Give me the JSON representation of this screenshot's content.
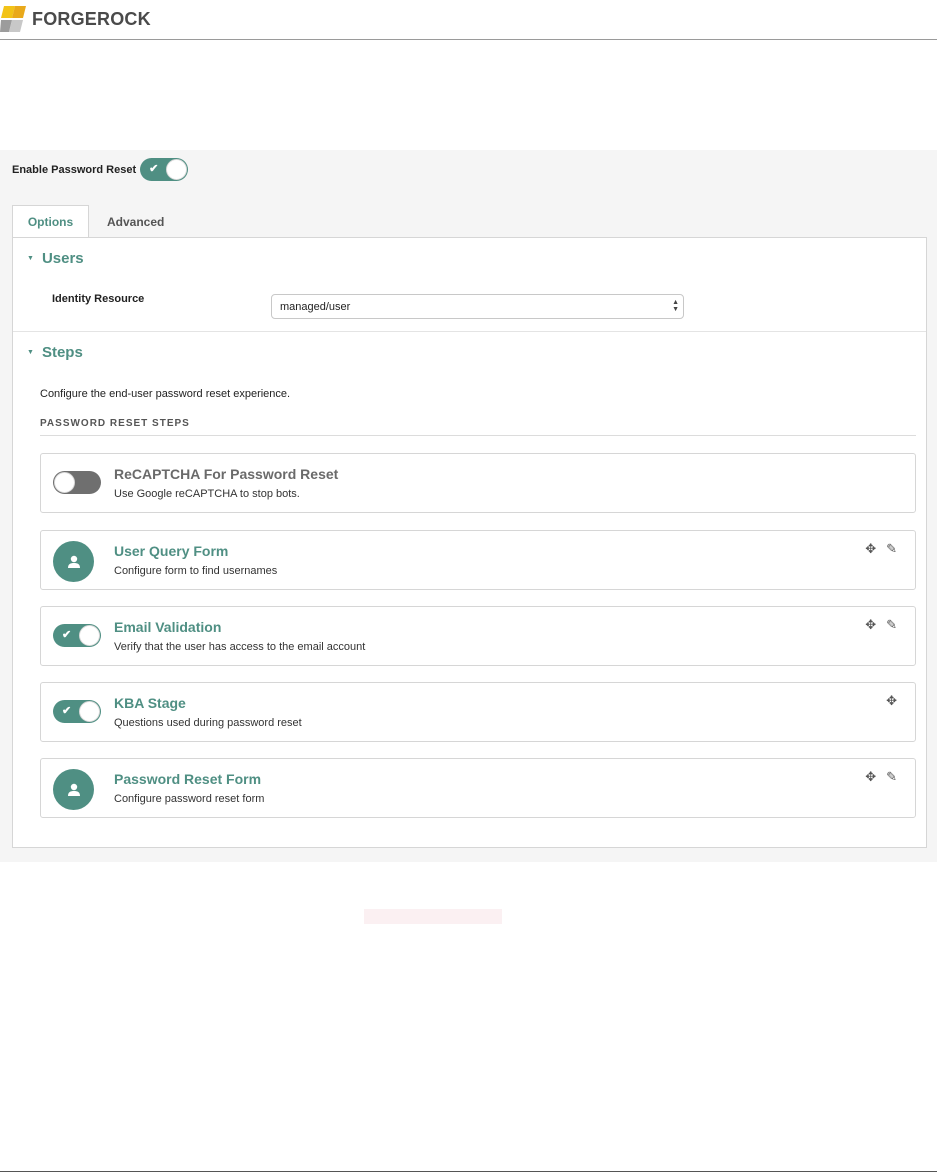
{
  "brand": {
    "name": "FORGEROCK",
    "accent": "#4f8f83"
  },
  "enable": {
    "label": "Enable Password Reset",
    "state": "on"
  },
  "tabs": [
    {
      "label": "Options",
      "active": true
    },
    {
      "label": "Advanced",
      "active": false
    }
  ],
  "users": {
    "title": "Users",
    "identity_label": "Identity Resource",
    "identity_value": "managed/user"
  },
  "steps": {
    "title": "Steps",
    "description": "Configure the end-user password reset experience.",
    "heading": "PASSWORD RESET STEPS",
    "items": [
      {
        "title": "ReCAPTCHA For Password Reset",
        "subtitle": "Use Google reCAPTCHA to stop bots.",
        "control": "toggle-off",
        "actions": []
      },
      {
        "title": "User Query Form",
        "subtitle": "Configure form to find usernames",
        "control": "avatar",
        "actions": [
          "move-icon",
          "edit-icon"
        ]
      },
      {
        "title": "Email Validation",
        "subtitle": "Verify that the user has access to the email account",
        "control": "toggle-on",
        "actions": [
          "move-icon",
          "edit-icon"
        ]
      },
      {
        "title": "KBA Stage",
        "subtitle": "Questions used during password reset",
        "control": "toggle-on",
        "actions": [
          "move-icon"
        ]
      },
      {
        "title": "Password Reset Form",
        "subtitle": "Configure password reset form",
        "control": "avatar",
        "actions": [
          "move-icon",
          "edit-icon"
        ]
      }
    ]
  }
}
